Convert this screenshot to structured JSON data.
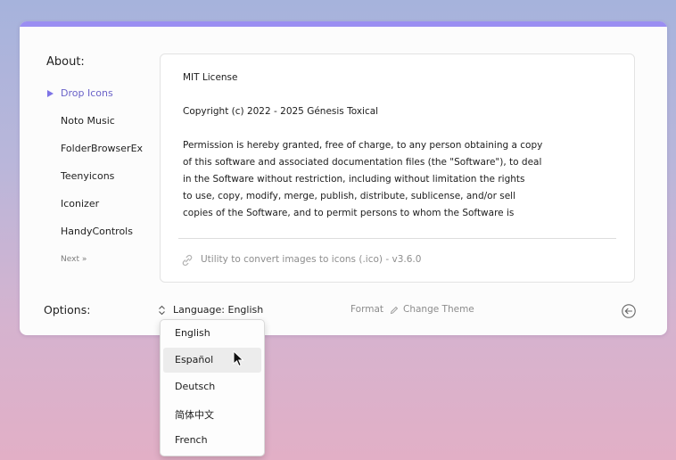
{
  "about": {
    "label": "About:",
    "items": [
      {
        "label": "Drop Icons",
        "active": true
      },
      {
        "label": "Noto Music",
        "active": false
      },
      {
        "label": "FolderBrowserEx",
        "active": false
      },
      {
        "label": "Teenyicons",
        "active": false
      },
      {
        "label": "Iconizer",
        "active": false
      },
      {
        "label": "HandyControls",
        "active": false
      }
    ],
    "next_label": "Next »"
  },
  "license": {
    "lines": [
      "MIT License",
      "",
      "Copyright (c) 2022 - 2025 Génesis Toxical",
      "",
      "Permission is hereby granted, free of charge, to any person obtaining a copy",
      "of this software and associated documentation files (the \"Software\"), to deal",
      "in the Software without restriction, including without limitation the rights",
      "to use, copy, modify, merge, publish, distribute, sublicense, and/or sell",
      "copies of the Software, and to permit persons to whom the Software is"
    ],
    "utility": "Utility to convert images to icons (.ico) - v3.6.0"
  },
  "options": {
    "label": "Options:",
    "language_select": "Language: English",
    "format_label": "Format",
    "change_theme_label": "Change Theme"
  },
  "language_dropdown": {
    "options": [
      "English",
      "Español",
      "Deutsch",
      "简体中文",
      "French"
    ],
    "hovered": "Español"
  },
  "colors": {
    "accent": "#9a8ef2",
    "active_item": "#6a62c8",
    "muted_text": "#8c8c8c"
  },
  "icons": [
    "link-icon",
    "updown-icon",
    "pencil-icon",
    "back-arrow-icon",
    "mouse-cursor-icon"
  ]
}
